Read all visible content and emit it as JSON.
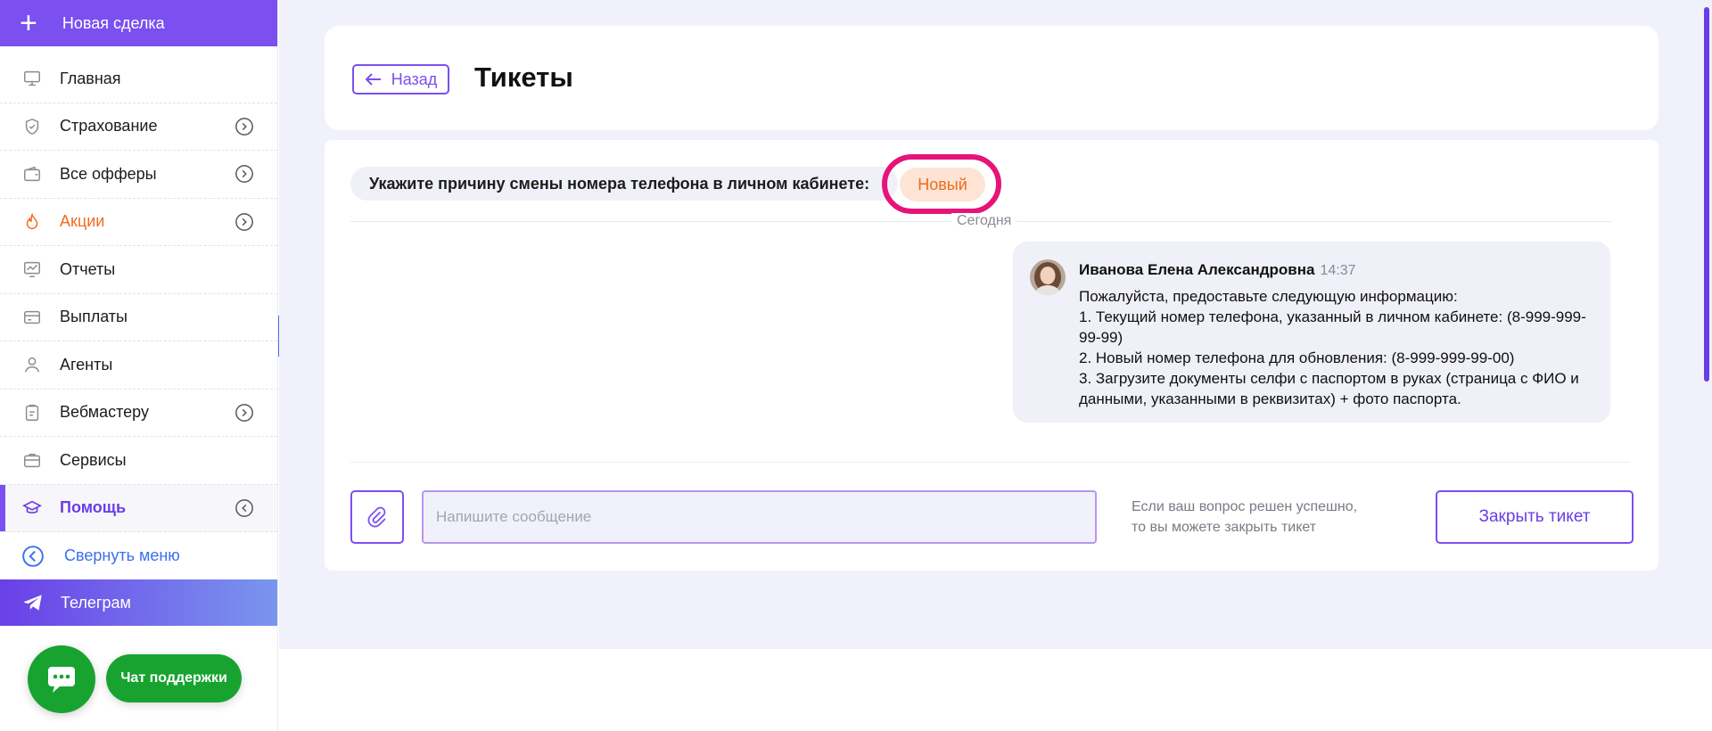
{
  "sidebar": {
    "new_deal_label": "Новая сделка",
    "items": [
      {
        "label": "Главная",
        "icon": "monitor-icon"
      },
      {
        "label": "Страхование",
        "icon": "shield-icon"
      },
      {
        "label": "Все офферы",
        "icon": "wallet-icon"
      },
      {
        "label": "Акции",
        "icon": "fire-icon"
      },
      {
        "label": "Отчеты",
        "icon": "chart-icon"
      },
      {
        "label": "Выплаты",
        "icon": "card-icon"
      },
      {
        "label": "Агенты",
        "icon": "user-icon"
      },
      {
        "label": "Вебмастеру",
        "icon": "clipboard-icon"
      },
      {
        "label": "Сервисы",
        "icon": "briefcase-icon"
      },
      {
        "label": "Помощь",
        "icon": "graduation-cap-icon"
      }
    ],
    "collapse_label": "Свернуть меню",
    "telegram_label": "Телеграм"
  },
  "support": {
    "chat_label": "Чат поддержки"
  },
  "header": {
    "back_label": "Назад",
    "title": "Тикеты"
  },
  "ticket": {
    "subject": "Укажите причину смены номера телефона в личном кабинете:",
    "status": "Новый",
    "date_separator": "Сегодня",
    "message": {
      "author": "Иванова Елена Александровна",
      "time": "14:37",
      "lines": [
        "Пожалуйста, предоставьте следующую информацию:",
        "1. Текущий номер телефона, указанный в личном кабинете: (8-999-999-99-99)",
        "2. Новый номер телефона для обновления: (8-999-999-99-00)",
        "3. Загрузите документы селфи с паспортом в руках (страница с ФИО и данными, указанными в реквизитах) + фото паспорта."
      ]
    }
  },
  "composer": {
    "placeholder": "Напишите сообщение",
    "close_hint": "Если ваш вопрос решен успешно, то вы можете закрыть тикет",
    "close_button": "Закрыть тикет"
  },
  "colors": {
    "accent": "#7b4ff0",
    "status_text": "#f06a1d",
    "status_bg": "#fde4d5",
    "highlight": "#e6147a",
    "support_green": "#18a331"
  }
}
